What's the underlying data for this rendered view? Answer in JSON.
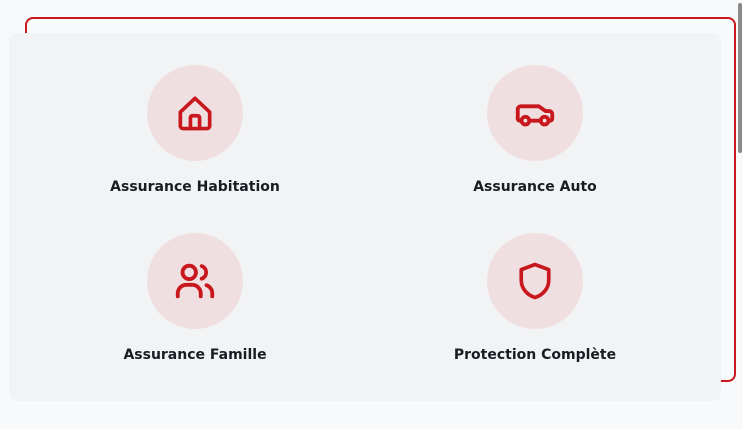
{
  "colors": {
    "accent": "#c8181e",
    "icon_bg": "#f0dfe1",
    "card_bg": "#f2f3f5",
    "text": "#1a1c24"
  },
  "services": [
    {
      "label": "Assurance Habitation",
      "icon": "home-icon"
    },
    {
      "label": "Assurance Auto",
      "icon": "car-icon"
    },
    {
      "label": "Assurance Famille",
      "icon": "users-icon"
    },
    {
      "label": "Protection Complète",
      "icon": "shield-icon"
    }
  ]
}
